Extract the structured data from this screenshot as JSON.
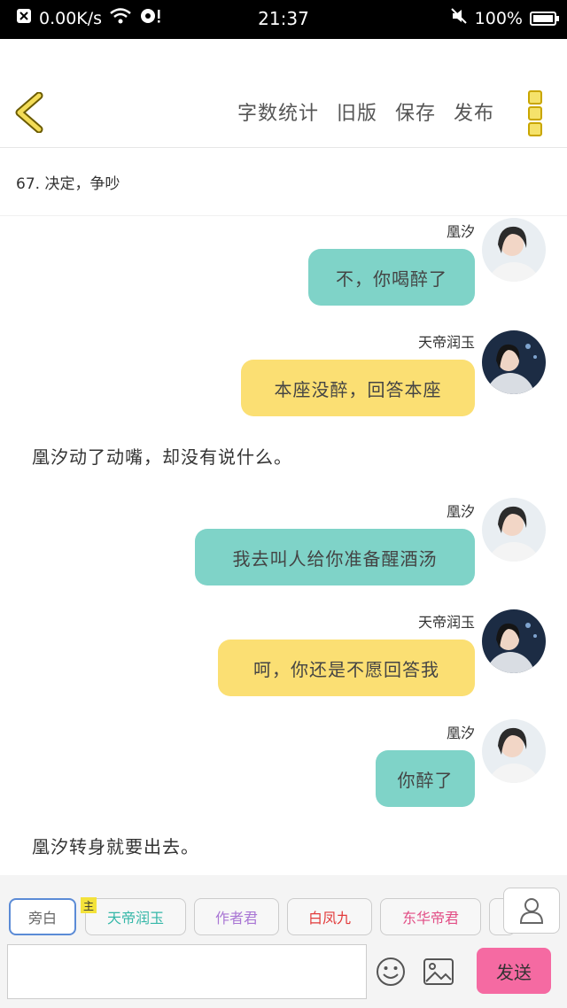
{
  "status_bar": {
    "speed": "0.00K/s",
    "time": "21:37",
    "battery": "100%"
  },
  "header": {
    "actions": [
      "字数统计",
      "旧版",
      "保存",
      "发布"
    ]
  },
  "chapter_title": "67. 决定，争吵",
  "messages": [
    {
      "name": "凰汐",
      "text": "不，你喝醉了"
    },
    {
      "name": "天帝润玉",
      "text": "本座没醉，回答本座"
    },
    {
      "narration": "凰汐动了动嘴，却没有说什么。"
    },
    {
      "name": "凰汐",
      "text": "我去叫人给你准备醒酒汤"
    },
    {
      "name": "天帝润玉",
      "text": "呵，你还是不愿回答我"
    },
    {
      "name": "凰汐",
      "text": "你醉了"
    },
    {
      "narration": "凰汐转身就要出去。"
    }
  ],
  "bottom": {
    "roles": [
      "旁白",
      "天帝润玉",
      "作者君",
      "白凤九",
      "东华帝君"
    ],
    "host_badge": "主",
    "role_colors": [
      "#777777",
      "#35b7a8",
      "#a976d4",
      "#e23b3b",
      "#e24f86"
    ],
    "send_label": "发送"
  },
  "colors": {
    "teal": "#7fd3c8",
    "yellow": "#fbdf73",
    "send": "#f56aa2"
  }
}
